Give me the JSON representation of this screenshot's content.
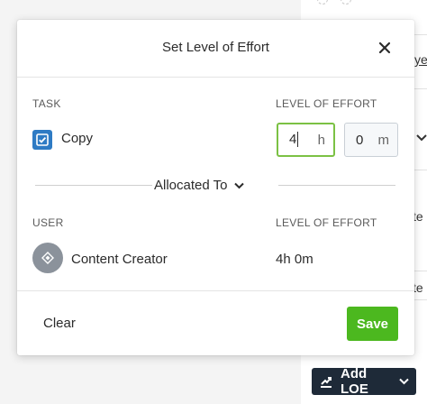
{
  "background": {
    "fragments": [
      "ye",
      "te",
      "te"
    ],
    "add_loe_label": "Add LOE"
  },
  "modal": {
    "title": "Set Level of Effort",
    "task_header": "TASK",
    "loe_header": "LEVEL OF EFFORT",
    "task": {
      "name": "Copy",
      "checked": true
    },
    "hours": {
      "value": "4",
      "unit": "h"
    },
    "minutes": {
      "value": "0",
      "unit": "m"
    },
    "allocated_label": "Allocated To",
    "user_header": "USER",
    "user_loe_header": "LEVEL OF EFFORT",
    "user": {
      "name": "Content Creator",
      "loe": "4h 0m"
    },
    "clear_label": "Clear",
    "save_label": "Save"
  },
  "colors": {
    "save": "#4cb81f",
    "task_icon": "#2e7bc4",
    "active_input_border": "#7bc144",
    "add_loe_bg": "#1e2a38",
    "avatar": "#8b929b"
  },
  "icons": {
    "close": "close-icon",
    "task": "checkbox-icon",
    "allocated": "chevron-down-icon",
    "avatar": "diamond-icon",
    "add_loe": "effort-chart-icon"
  }
}
